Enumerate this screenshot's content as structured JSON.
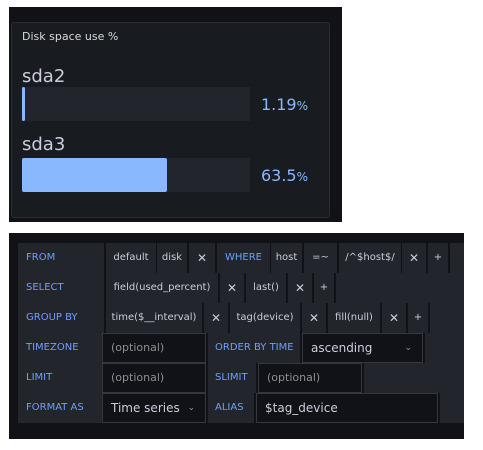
{
  "gauge_panel": {
    "title": "Disk space use %",
    "items": [
      {
        "label": "sda2",
        "value": "1.19",
        "unit": "%",
        "fill_percent": 1.19
      },
      {
        "label": "sda3",
        "value": "63.5",
        "unit": "%",
        "fill_percent": 63.5
      }
    ],
    "colors": {
      "bar": "#8ab8ff",
      "track": "#22252b",
      "panel_bg": "#181b1f"
    }
  },
  "query_editor": {
    "from": {
      "label": "FROM",
      "policy": "default",
      "measurement": "disk",
      "remove": "✕",
      "where_label": "WHERE",
      "tag_key": "host",
      "operator": "=~",
      "tag_value": "/^$host$/",
      "remove2": "✕",
      "add": "+"
    },
    "select": {
      "label": "SELECT",
      "field": "field(used_percent)",
      "remove": "✕",
      "func": "last()",
      "remove2": "✕",
      "add": "+"
    },
    "group_by": {
      "label": "GROUP BY",
      "time": "time($__interval)",
      "remove": "✕",
      "tag": "tag(device)",
      "remove2": "✕",
      "fill": "fill(null)",
      "remove3": "✕",
      "add": "+"
    },
    "timezone": {
      "label": "TIMEZONE",
      "placeholder": "(optional)",
      "order_label": "ORDER BY TIME",
      "order_value": "ascending"
    },
    "limit": {
      "label": "LIMIT",
      "placeholder": "(optional)",
      "slimit_label": "SLIMIT",
      "slimit_placeholder": "(optional)"
    },
    "format": {
      "label": "FORMAT AS",
      "value": "Time series",
      "alias_label": "ALIAS",
      "alias_value": "$tag_device"
    },
    "icons": {
      "chevron": "chevron-down-icon"
    }
  }
}
